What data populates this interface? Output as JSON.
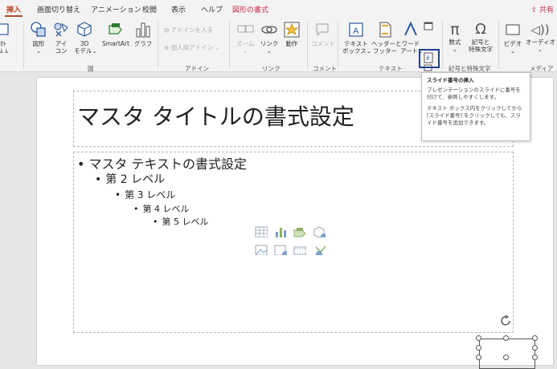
{
  "tabs": [
    {
      "label": "挿入",
      "active": true
    },
    {
      "label": "画面切り替え"
    },
    {
      "label": "アニメーション"
    },
    {
      "label": "校閲"
    },
    {
      "label": "表示"
    },
    {
      "label": "ヘルプ"
    },
    {
      "label": "図形の書式",
      "context": true
    }
  ],
  "share_label": "共有",
  "ribbon": {
    "partial_left": [
      "ｵﾄ",
      "ﾑ ﾑ"
    ],
    "illustrations": {
      "shapes": "図形",
      "icons_line1": "アイ",
      "icons_line2": "コン",
      "models_line1": "3D",
      "models_line2": "モデル",
      "smartart": "SmartArt",
      "chart": "グラフ",
      "group_label": "図"
    },
    "addins": {
      "get_addins": "アドインを入手",
      "my_addins": "個人用アドイン",
      "group_label": "アドイン"
    },
    "links": {
      "zoom": "ズーム",
      "link": "リンク",
      "action": "動作",
      "group_label": "リンク"
    },
    "comments": {
      "comment": "コメント",
      "group_label": "コメント"
    },
    "text": {
      "textbox_line1": "テキスト",
      "textbox_line2": "ボックス",
      "header_line1": "ヘッダーと",
      "header_line2": "フッター",
      "wordart_line1": "ワード",
      "wordart_line2": "アート",
      "group_label": "テキスト"
    },
    "symbols": {
      "equation": "数式",
      "symbol_line1": "記号と",
      "symbol_line2": "特殊文字",
      "group_label": "記号と特殊文字"
    },
    "media": {
      "video": "ビデオ",
      "audio": "オーディオ",
      "group_label": "メディア"
    }
  },
  "tooltip": {
    "title": "スライド番号の挿入",
    "para1": "プレゼンテーションのスライドに番号を付けて、参照しやすくします。",
    "para2": "テキスト ボックス内をクリックしてから [スライド番号] をクリックしても、スライド番号を追加できます。"
  },
  "slide": {
    "title": "マスタ タイトルの書式設定",
    "levels": [
      "マスタ テキストの書式設定",
      "第 2 レベル",
      "第 3 レベル",
      "第 4 レベル",
      "第 5 レベル"
    ]
  },
  "colors": {
    "accent": "#b7472a",
    "highlight": "#1f3f8f"
  }
}
